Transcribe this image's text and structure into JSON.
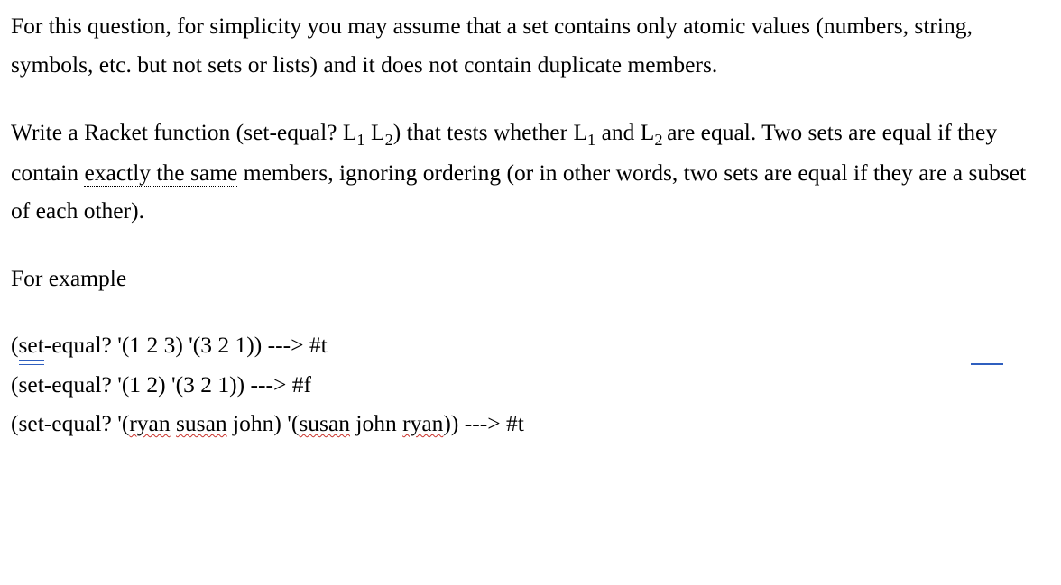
{
  "para1": {
    "full": "For this question, for simplicity you may assume that a set contains only atomic values (numbers, string, symbols, etc. but not sets or lists) and it does not contain duplicate members."
  },
  "para2": {
    "lead": "Write a Racket function (set-equal? L",
    "sub1": "1",
    "mid1": " L",
    "sub2": "2",
    "mid2": ") that tests whether L",
    "sub3": "1",
    "mid3": " and L",
    "sub4": "2 ",
    "mid4": "are equal. Two sets are equal if they contain ",
    "underlined": "exactly the same",
    "tail": " members, ignoring ordering (or in other words, two sets are equal if they are a subset of each other)."
  },
  "para3": {
    "text": "For example"
  },
  "ex1": {
    "a": "(",
    "set_word": "set",
    "b": "-equal? '(1 2 3) '(3 2 1)) ---> #t"
  },
  "ex2": {
    "full": "(set-equal? '(1 2) '(3 2 1)) ---> #f"
  },
  "ex3": {
    "a": "(set-equal? '(",
    "ryan": "ryan",
    "sp1": " ",
    "susan": "susan",
    "b": " john) '(",
    "susan2": "susan",
    "c": " john ",
    "ryan2": "ryan",
    "d": ")) ---> #t"
  }
}
